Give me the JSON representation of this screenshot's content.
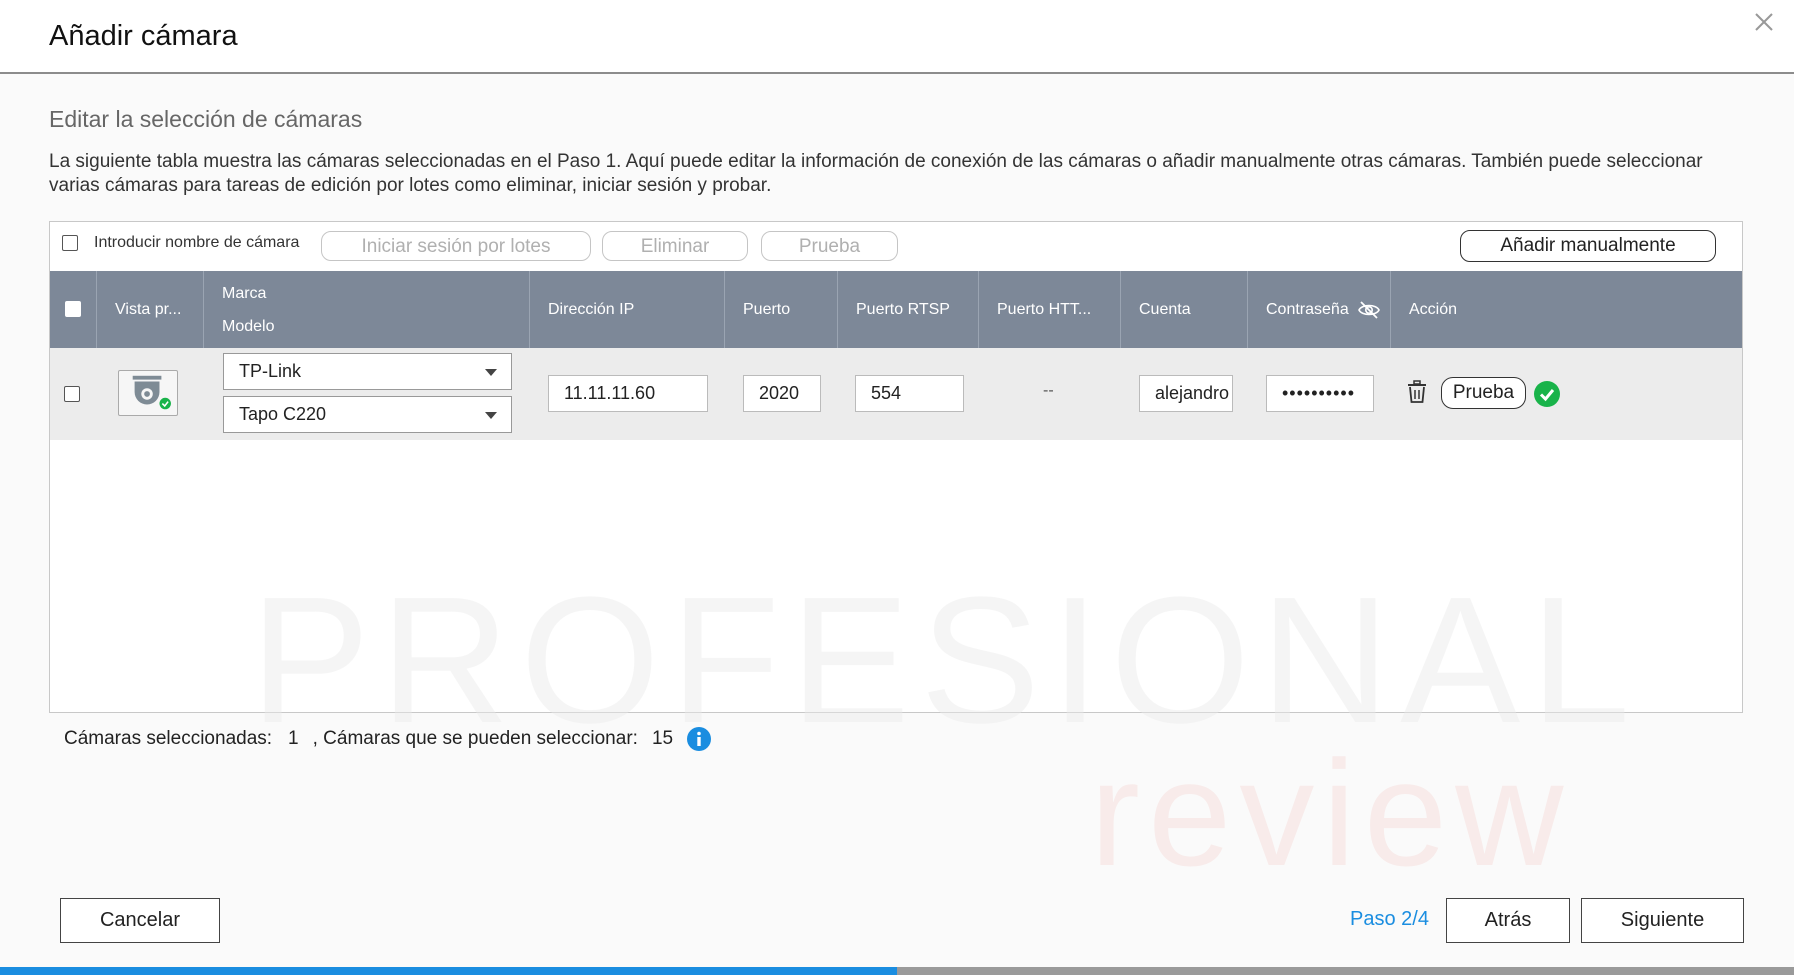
{
  "dialog": {
    "title": "Añadir cámara"
  },
  "section": {
    "subtitle": "Editar la selección de cámaras",
    "description": "La siguiente tabla muestra las cámaras seleccionadas en el Paso 1. Aquí puede editar la información de conexión de las cámaras o añadir manualmente otras cámaras. También puede seleccionar varias cámaras para tareas de edición por lotes como eliminar, iniciar sesión y probar."
  },
  "toolbar": {
    "name_label": "Introducir nombre de cámara",
    "batch_login": "Iniciar sesión por lotes",
    "delete": "Eliminar",
    "test": "Prueba",
    "add_manual": "Añadir manualmente"
  },
  "columns": {
    "preview": "Vista pr...",
    "brand": "Marca",
    "model": "Modelo",
    "ip": "Dirección IP",
    "port": "Puerto",
    "rtsp": "Puerto RTSP",
    "http": "Puerto HTT...",
    "account": "Cuenta",
    "password": "Contraseña",
    "action": "Acción"
  },
  "rows": [
    {
      "brand": "TP-Link",
      "model": "Tapo C220",
      "ip": "11.11.11.60",
      "port": "2020",
      "rtsp": "554",
      "http": "--",
      "account": "alejandro",
      "password": "••••••••••",
      "test": "Prueba",
      "status": "connected"
    }
  ],
  "watermark": {
    "line1": "PROFESIONAL",
    "line2": "review"
  },
  "footer": {
    "selected_label": "Cámaras seleccionadas:",
    "selected_count": "1",
    "selectable_label": ", Cámaras que se pueden seleccionar:",
    "selectable_count": "15",
    "cancel": "Cancelar",
    "step": "Paso 2/4",
    "back": "Atrás",
    "next": "Siguiente"
  },
  "progress": {
    "value": 0.5
  },
  "colors": {
    "accent": "#1a8de0",
    "header": "#7d8898",
    "success": "#19b34a"
  },
  "icons": [
    "close-icon",
    "camera-icon",
    "eye-off-icon",
    "trash-icon",
    "check-circle-icon",
    "info-icon",
    "caret-down-icon"
  ]
}
